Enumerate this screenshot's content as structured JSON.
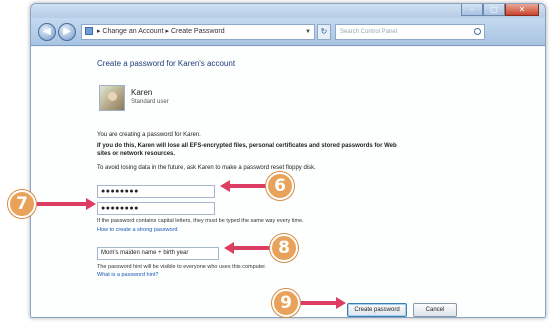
{
  "window": {
    "breadcrumb": [
      "Change an Account",
      "Create Password"
    ],
    "search_placeholder": "Search Control Panel",
    "minimize": "–",
    "maximize": "□",
    "close": "✕"
  },
  "page": {
    "title": "Create a password for Karen's account",
    "user_name": "Karen",
    "user_type": "Standard user",
    "line1": "You are creating a password for Karen.",
    "warning_line1": "If you do this, Karen will lose all EFS-encrypted files, personal certificates and stored passwords for Web",
    "warning_line2": "sites or network resources.",
    "line2": "To avoid losing data in the future, ask Karen to make a password reset floppy disk.",
    "password_value": "●●●●●●●●",
    "confirm_value": "●●●●●●●●",
    "caps_hint": "If the password contains capital letters, they must be typed the same way every time.",
    "strong_link": "How to create a strong password",
    "hint_value": "Mom's maiden name + birth year",
    "hint_visibility": "The password hint will be visible to everyone who uses this computer.",
    "hint_link": "What is a password hint?",
    "create_button": "Create password",
    "cancel_button": "Cancel"
  },
  "callouts": [
    "6",
    "7",
    "8",
    "9"
  ],
  "colors": {
    "callout": "#e8a25a",
    "arrow": "#dd3d63"
  }
}
